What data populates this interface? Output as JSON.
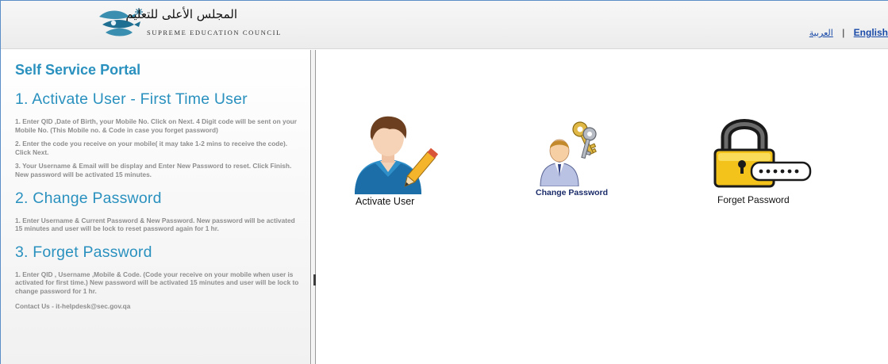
{
  "header": {
    "logo_arabic": "المجلس الأعلى للتعليم",
    "logo_english": "SUPREME EDUCATION COUNCIL",
    "lang_arabic": "العربية",
    "lang_separator": "|",
    "lang_english": "English"
  },
  "left_panel": {
    "portal_title": "Self Service Portal",
    "sections": [
      {
        "title": "1. Activate User - First Time User",
        "steps": [
          "1. Enter QID ,Date of Birth, your Mobile No. Click on Next. 4 Digit code will be sent on your Mobile No. (This Mobile no. & Code in case you forget password)",
          "2. Enter the code you receive on your mobile( it may take 1-2 mins to receive the code). Click Next.",
          "3. Your Username & Email will be display and Enter New Password to reset. Click Finish. New password will be activated 15 minutes."
        ]
      },
      {
        "title": "2. Change Password",
        "steps": [
          "1. Enter Username & Current Password & New Password. New password will be activated 15 minutes and user will be lock to reset password again for 1 hr."
        ]
      },
      {
        "title": "3. Forget Password",
        "steps": [
          "1. Enter QID , Username ,Mobile & Code. (Code your receive on your mobile when user is activated for first time.) New password will be activated 15 minutes and user will be lock to change password for 1 hr."
        ]
      }
    ],
    "contact": "Contact Us - it-helpdesk@sec.gov.qa"
  },
  "tiles": {
    "activate_user": {
      "label": "Activate User",
      "icon": "user-edit-icon"
    },
    "change_password": {
      "label": "Change Password",
      "icon": "user-keys-icon"
    },
    "forget_password": {
      "label": "Forget Password",
      "icon": "padlock-password-icon"
    }
  },
  "colors": {
    "accent": "#2a91bf",
    "link": "#1a4aa8",
    "step_text": "#8e8e8e",
    "frame_border": "#5b8ec7"
  }
}
